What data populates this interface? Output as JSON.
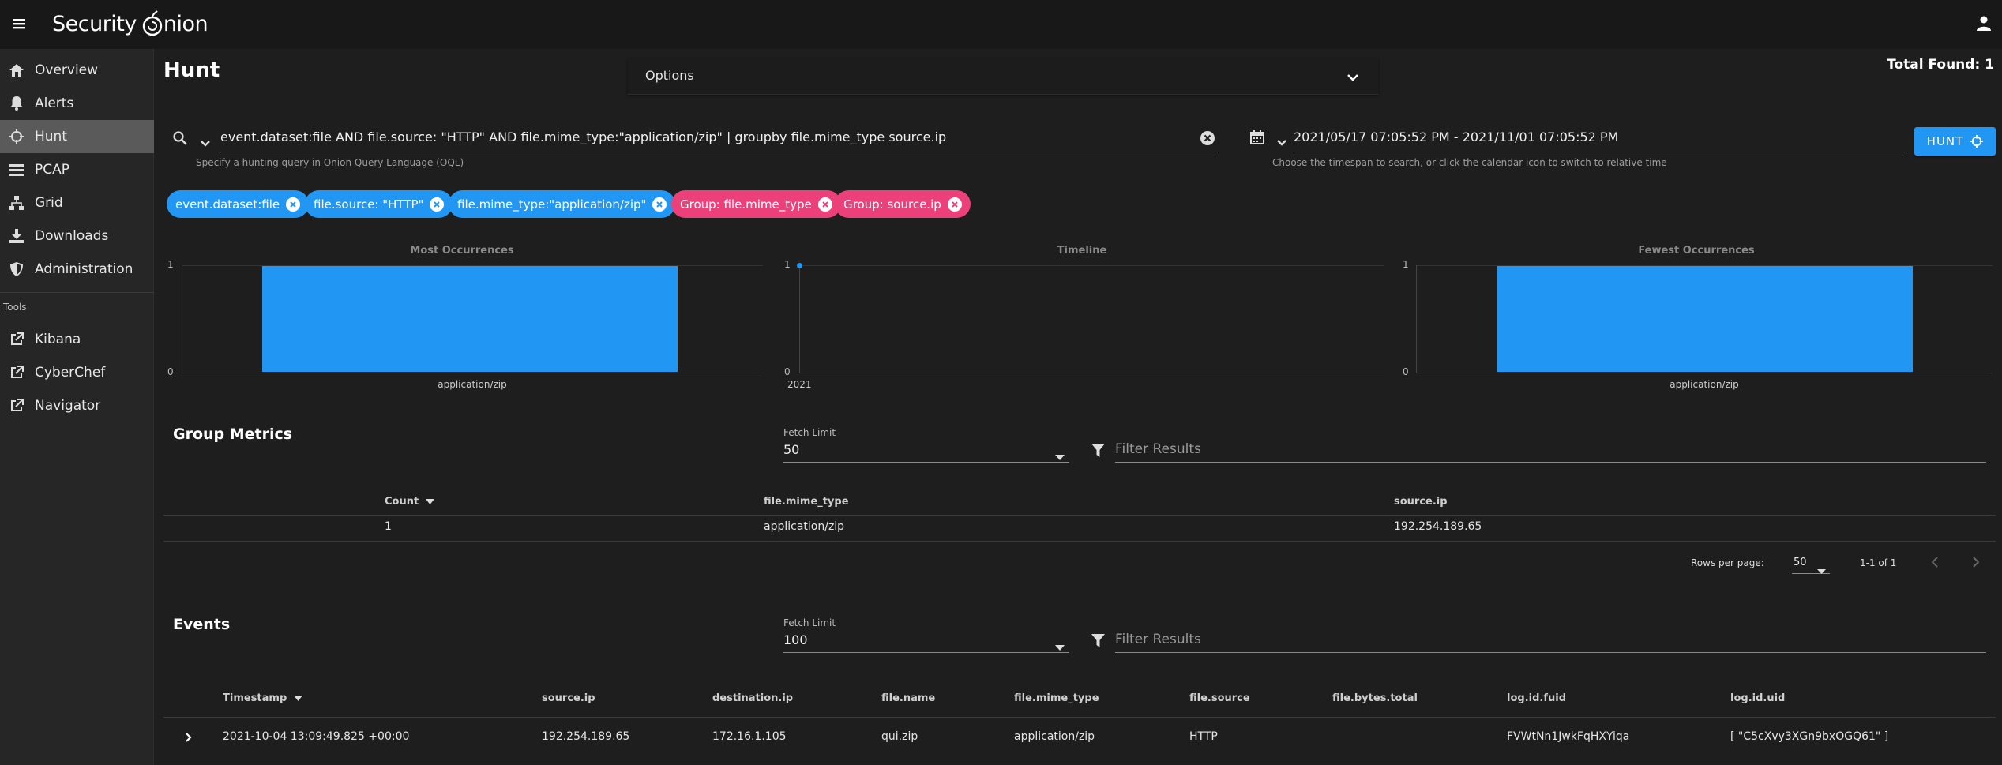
{
  "app": {
    "brand": "Security Onion",
    "brand_part1": "Security",
    "brand_part2": "nion"
  },
  "sidebar": {
    "items": [
      {
        "label": "Overview",
        "icon": "home-icon"
      },
      {
        "label": "Alerts",
        "icon": "bell-icon"
      },
      {
        "label": "Hunt",
        "icon": "crosshairs-icon",
        "active": true
      },
      {
        "label": "PCAP",
        "icon": "pcap-icon"
      },
      {
        "label": "Grid",
        "icon": "sitemap-icon"
      },
      {
        "label": "Downloads",
        "icon": "download-icon"
      },
      {
        "label": "Administration",
        "icon": "shield-icon"
      }
    ],
    "tools_label": "Tools",
    "tools": [
      {
        "label": "Kibana",
        "icon": "external-link-icon"
      },
      {
        "label": "CyberChef",
        "icon": "external-link-icon"
      },
      {
        "label": "Navigator",
        "icon": "external-link-icon"
      }
    ]
  },
  "page": {
    "title": "Hunt",
    "total_found": "Total Found: 1",
    "options_label": "Options"
  },
  "query": {
    "value": "event.dataset:file AND file.source: \"HTTP\" AND file.mime_type:\"application/zip\" | groupby file.mime_type source.ip",
    "hint": "Specify a hunting query in Onion Query Language (OQL)"
  },
  "daterange": {
    "value": "2021/05/17 07:05:52 PM - 2021/11/01 07:05:52 PM",
    "hint": "Choose the timespan to search, or click the calendar icon to switch to relative time"
  },
  "hunt_button": "HUNT",
  "chips": [
    {
      "label": "event.dataset:file",
      "color": "#2196f3"
    },
    {
      "label": "file.source: \"HTTP\"",
      "color": "#2196f3"
    },
    {
      "label": "file.mime_type:\"application/zip\"",
      "color": "#2196f3"
    },
    {
      "label": "Group: file.mime_type",
      "color": "#ec407a"
    },
    {
      "label": "Group: source.ip",
      "color": "#ec407a"
    }
  ],
  "charts": {
    "most": {
      "title": "Most Occurrences",
      "y_top": "1",
      "y_bottom": "0",
      "x_label": "application/zip"
    },
    "timeline": {
      "title": "Timeline",
      "y_top": "1",
      "y_bottom": "0",
      "x_label": "2021"
    },
    "fewest": {
      "title": "Fewest Occurrences",
      "y_top": "1",
      "y_bottom": "0",
      "x_label": "application/zip"
    }
  },
  "chart_data": [
    {
      "type": "bar",
      "title": "Most Occurrences",
      "categories": [
        "application/zip"
      ],
      "values": [
        1
      ],
      "ylim": [
        0,
        1
      ]
    },
    {
      "type": "line",
      "title": "Timeline",
      "x": [
        "2021"
      ],
      "values": [
        1
      ],
      "ylim": [
        0,
        1
      ]
    },
    {
      "type": "bar",
      "title": "Fewest Occurrences",
      "categories": [
        "application/zip"
      ],
      "values": [
        1
      ],
      "ylim": [
        0,
        1
      ]
    }
  ],
  "group_metrics": {
    "title": "Group Metrics",
    "fetch_limit_label": "Fetch Limit",
    "fetch_limit_value": "50",
    "filter_placeholder": "Filter Results",
    "columns": [
      "Count",
      "file.mime_type",
      "source.ip"
    ],
    "rows": [
      {
        "count": "1",
        "mime": "application/zip",
        "ip": "192.254.189.65"
      }
    ],
    "rows_per_page_label": "Rows per page:",
    "rows_per_page_value": "50",
    "range": "1-1 of 1"
  },
  "events": {
    "title": "Events",
    "fetch_limit_label": "Fetch Limit",
    "fetch_limit_value": "100",
    "filter_placeholder": "Filter Results",
    "columns": [
      "Timestamp",
      "source.ip",
      "destination.ip",
      "file.name",
      "file.mime_type",
      "file.source",
      "file.bytes.total",
      "log.id.fuid",
      "log.id.uid"
    ],
    "rows": [
      {
        "timestamp": "2021-10-04 13:09:49.825 +00:00",
        "src": "192.254.189.65",
        "dst": "172.16.1.105",
        "name": "qui.zip",
        "mime": "application/zip",
        "source": "HTTP",
        "bytes": "",
        "fuid": "FVWtNn1JwkFqHXYiqa",
        "uid": "[ \"C5cXvy3XGn9bxOGQ61\" ]"
      }
    ]
  },
  "colors": {
    "accent": "#2196f3",
    "group_chip": "#ec407a",
    "topbar": "#181818",
    "sidebar": "#262626",
    "background": "#1e1e1e"
  }
}
